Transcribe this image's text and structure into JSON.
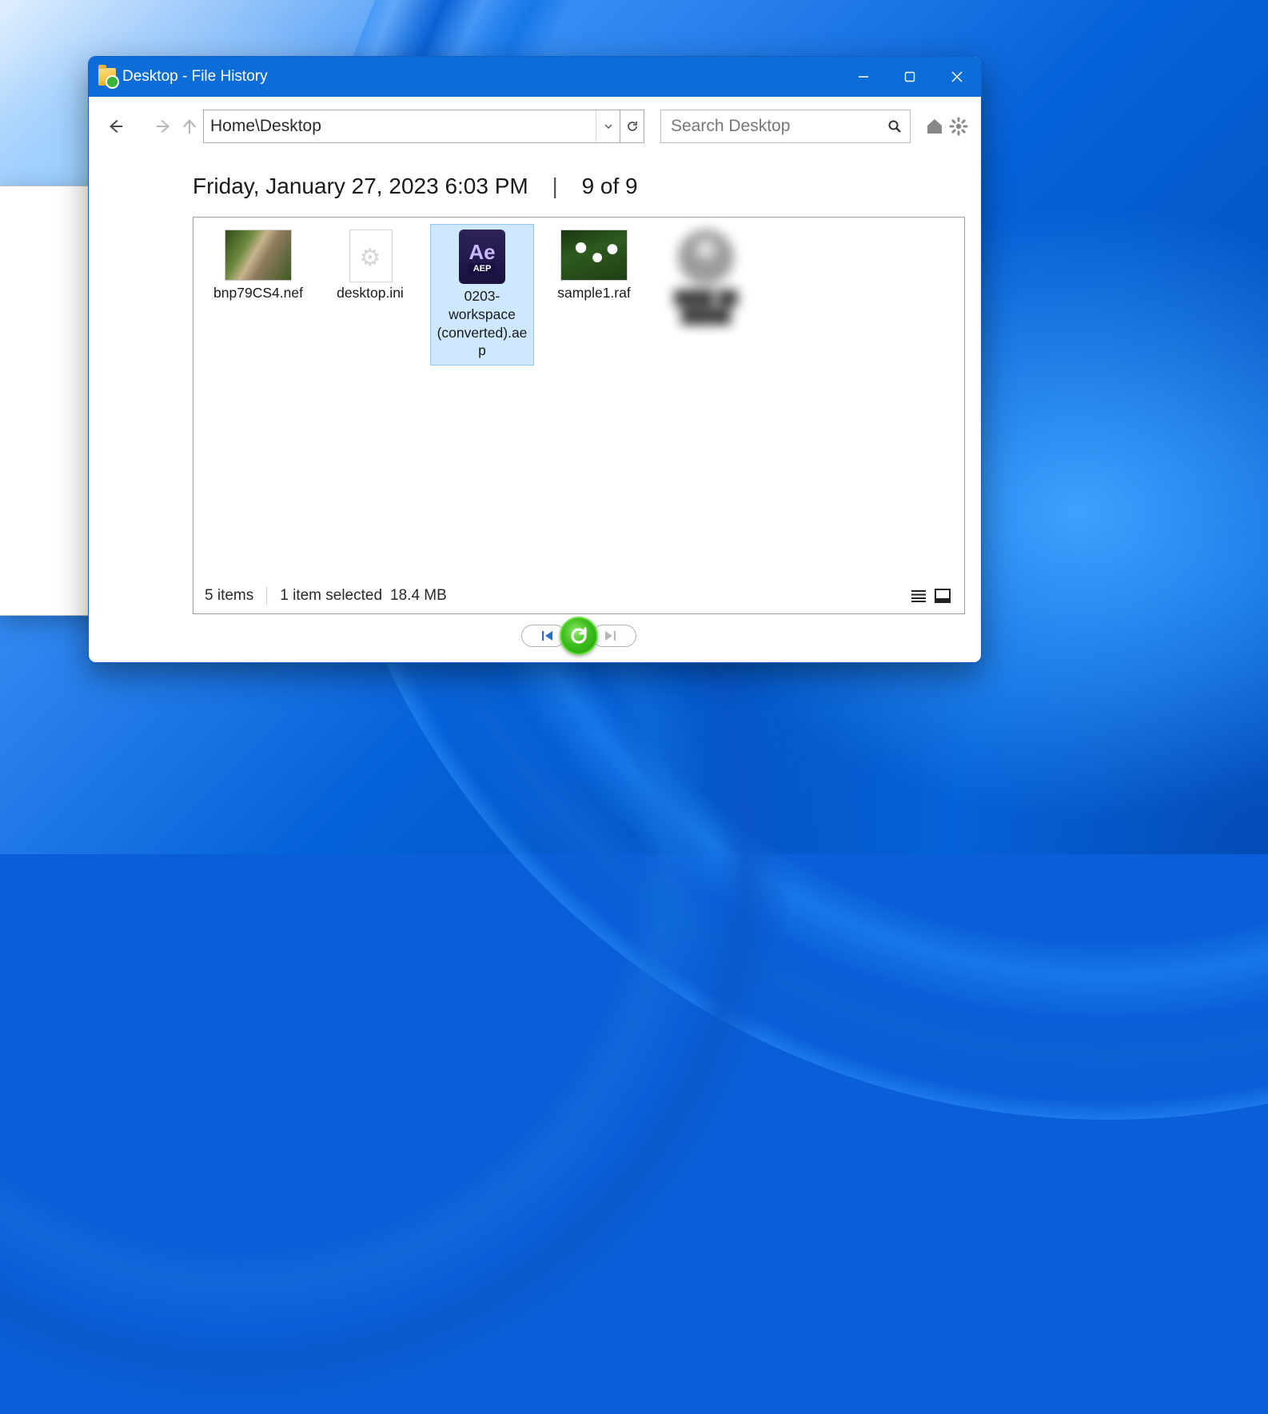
{
  "window": {
    "title": "Desktop - File History"
  },
  "toolbar": {
    "address": "Home\\Desktop",
    "search_placeholder": "Search Desktop"
  },
  "heading": {
    "timestamp": "Friday, January 27, 2023 6:03 PM",
    "position": "9 of 9"
  },
  "files": [
    {
      "name": "bnp79CS4.nef",
      "type": "photo",
      "selected": false
    },
    {
      "name": "desktop.ini",
      "type": "ini",
      "selected": false
    },
    {
      "name": "0203-workspace (converted).aep",
      "type": "aep",
      "selected": true
    },
    {
      "name": "sample1.raf",
      "type": "photo2",
      "selected": false
    },
    {
      "name": "",
      "type": "avatar",
      "selected": false,
      "blurred": true
    }
  ],
  "status": {
    "count": "5 items",
    "selected": "1 item selected",
    "size": "18.4 MB"
  }
}
